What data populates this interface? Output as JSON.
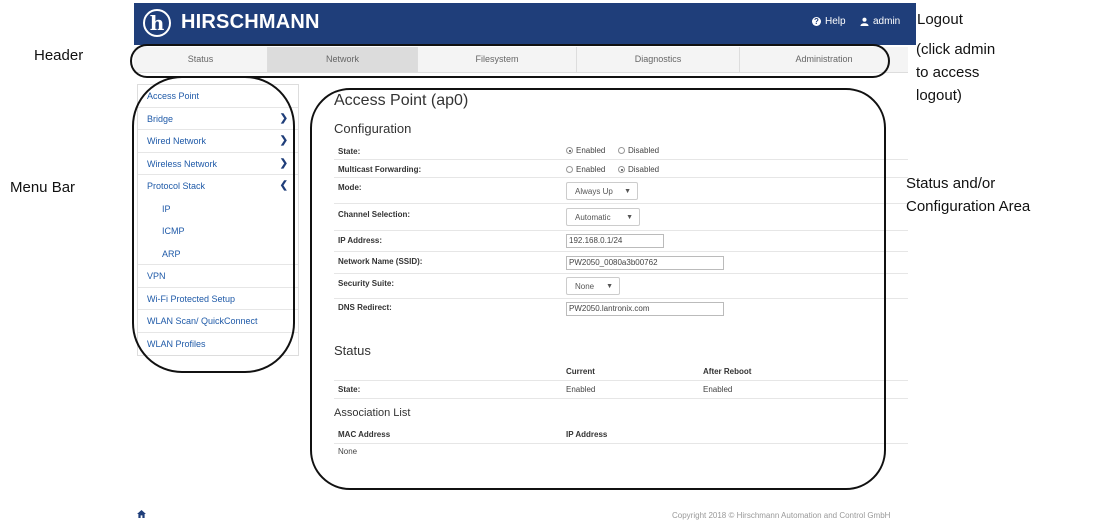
{
  "header": {
    "brand": "HIRSCHMANN",
    "logo_glyph": "h",
    "help_label": "Help",
    "admin_label": "admin",
    "accent_color": "#1f3e7a"
  },
  "tabs": [
    {
      "label": "Status",
      "active": false
    },
    {
      "label": "Network",
      "active": true
    },
    {
      "label": "Filesystem",
      "active": false
    },
    {
      "label": "Diagnostics",
      "active": false
    },
    {
      "label": "Administration",
      "active": false
    }
  ],
  "sidebar": {
    "items": [
      {
        "label": "Access Point"
      },
      {
        "label": "Bridge",
        "icon": "chevron-right-icon"
      },
      {
        "label": "Wired Network",
        "icon": "chevron-right-icon"
      },
      {
        "label": "Wireless Network",
        "icon": "chevron-right-icon"
      },
      {
        "label": "Protocol Stack",
        "icon": "chevron-left-icon"
      },
      {
        "label": "IP"
      },
      {
        "label": "ICMP"
      },
      {
        "label": "ARP"
      },
      {
        "label": "VPN"
      },
      {
        "label": "Wi-Fi Protected Setup"
      },
      {
        "label": "WLAN Scan/ QuickConnect"
      },
      {
        "label": "WLAN Profiles"
      }
    ]
  },
  "main": {
    "title": "Access Point (ap0)",
    "configuration": {
      "heading": "Configuration",
      "state_label": "State:",
      "state_enabled": "Enabled",
      "state_disabled": "Disabled",
      "multicast_label": "Multicast Forwarding:",
      "multicast_enabled": "Enabled",
      "multicast_disabled": "Disabled",
      "mode_label": "Mode:",
      "mode_value": "Always Up",
      "channel_label": "Channel Selection:",
      "channel_value": "Automatic",
      "ip_label": "IP Address:",
      "ip_value": "192.168.0.1/24",
      "ssid_label": "Network Name (SSID):",
      "ssid_value": "PW2050_0080a3b00762",
      "security_label": "Security Suite:",
      "security_value": "None",
      "dns_label": "DNS Redirect:",
      "dns_value": "PW2050.lantronix.com"
    },
    "status": {
      "heading": "Status",
      "col_current": "Current",
      "col_after": "After Reboot",
      "state_label": "State:",
      "state_current": "Enabled",
      "state_after": "Enabled"
    },
    "association": {
      "heading": "Association List",
      "col_mac": "MAC Address",
      "col_ip": "IP Address",
      "empty": "None"
    }
  },
  "footer": {
    "copyright": "Copyright 2018 © Hirschmann Automation and Control GmbH"
  },
  "annotations": {
    "header": "Header",
    "menu_bar": "Menu Bar",
    "logout_title": "Logout",
    "logout_note_1": "(click admin",
    "logout_note_2": "to access",
    "logout_note_3": "logout)",
    "status_area_1": "Status and/or",
    "status_area_2": "Configuration Area"
  }
}
